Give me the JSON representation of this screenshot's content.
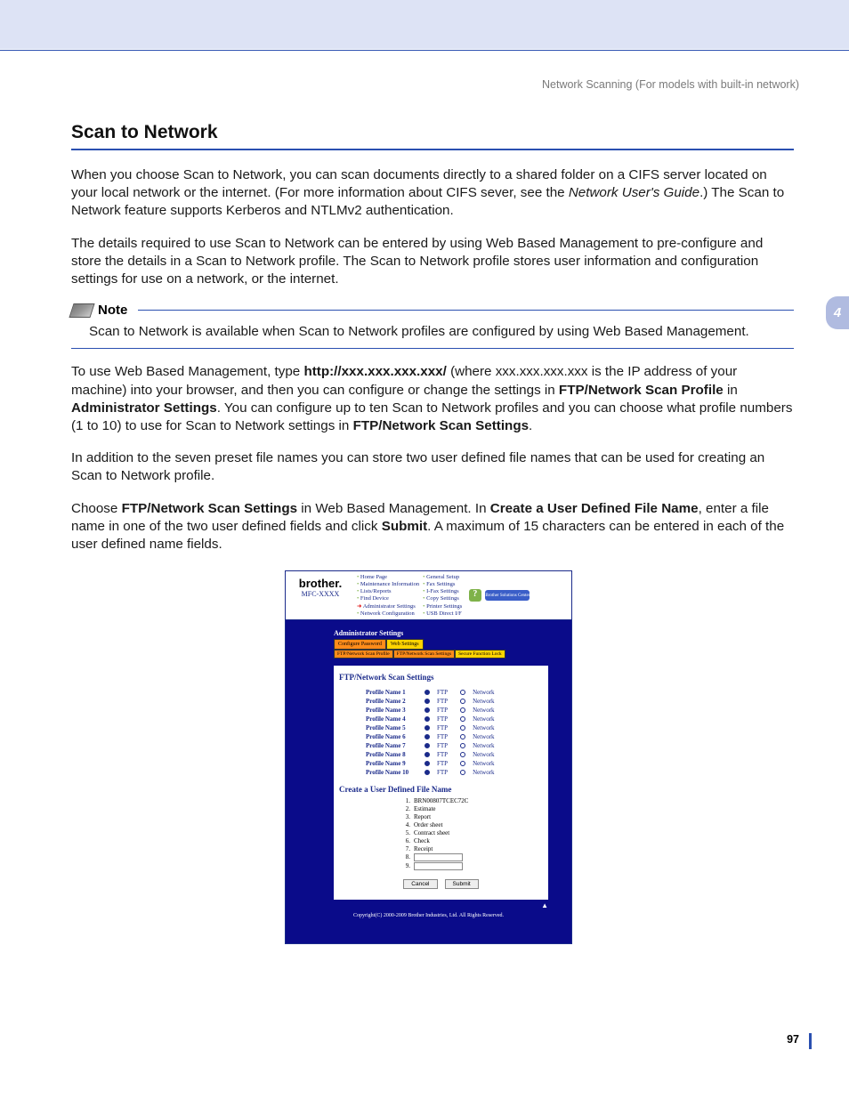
{
  "chapter_number": "4",
  "running_head": "Network Scanning (For models with built-in network)",
  "page_number": "97",
  "heading": "Scan to Network",
  "paragraphs": {
    "p1_a": "When you choose Scan to Network, you can scan documents directly to a shared folder on a CIFS server located on your local network or the internet. (For more information about CIFS sever, see the ",
    "p1_i": "Network User's Guide",
    "p1_b": ".) The Scan to Network feature supports Kerberos and NTLMv2 authentication.",
    "p2": "The details required to use Scan to Network can be entered by using Web Based Management to pre-configure and store the details in a Scan to Network profile. The Scan to Network profile stores user information and configuration settings for use on a network, or the internet.",
    "p3_a": "To use Web Based Management, type ",
    "p3_b": "http://xxx.xxx.xxx.xxx/",
    "p3_c": " (where xxx.xxx.xxx.xxx is the IP address of your machine) into your browser, and then you can configure or change the settings in ",
    "p3_d": "FTP/Network Scan Profile",
    "p3_e": " in ",
    "p3_f": "Administrator Settings",
    "p3_g": ". You can configure up to ten Scan to Network profiles and you can choose what profile numbers (1 to 10) to use for Scan to Network settings in ",
    "p3_h": "FTP/Network Scan Settings",
    "p3_i": ".",
    "p4": "In addition to the seven preset file names you can store two user defined file names that can be used for creating an Scan to Network profile.",
    "p5_a": "Choose ",
    "p5_b": "FTP/Network Scan Settings",
    "p5_c": " in Web Based Management. In ",
    "p5_d": "Create a User Defined File Name",
    "p5_e": ", enter a file name in one of the two user defined fields and click ",
    "p5_f": "Submit",
    "p5_g": ". A maximum of 15 characters can be entered in each of the user defined name fields."
  },
  "note": {
    "label": "Note",
    "body": "Scan to Network is available when Scan to Network profiles are configured by using Web Based Management."
  },
  "webshot": {
    "brand": "brother.",
    "model": "MFC-XXXX",
    "nav_left": [
      "Home Page",
      "Maintenance Information",
      "Lists/Reports",
      "Find Device",
      "Administrator Settings",
      "Network Configuration"
    ],
    "nav_right": [
      "General Setup",
      "Fax Settings",
      "I-Fax Settings",
      "Copy Settings",
      "Printer Settings",
      "USB Direct I/F"
    ],
    "bsc": "Brother Solutions Center",
    "admin_title": "Administrator Settings",
    "tabs1": [
      "Configure Password",
      "Web Settings"
    ],
    "tabs2": [
      "FTP/Network Scan Profile",
      "FTP/Network Scan Settings",
      "Secure Function Lock"
    ],
    "panel_title": "FTP/Network Scan Settings",
    "profile_label_prefix": "Profile Name ",
    "radio_ftp": "FTP",
    "radio_net": "Network",
    "profiles": [
      {
        "n": "1",
        "sel": "ftp"
      },
      {
        "n": "2",
        "sel": "ftp"
      },
      {
        "n": "3",
        "sel": "ftp"
      },
      {
        "n": "4",
        "sel": "ftp"
      },
      {
        "n": "5",
        "sel": "ftp"
      },
      {
        "n": "6",
        "sel": "ftp"
      },
      {
        "n": "7",
        "sel": "ftp"
      },
      {
        "n": "8",
        "sel": "ftp"
      },
      {
        "n": "9",
        "sel": "ftp"
      },
      {
        "n": "10",
        "sel": "ftp"
      }
    ],
    "panel_title2": "Create a User Defined File Name",
    "filenames": [
      {
        "n": "1.",
        "v": "BRN00807TCEC72C"
      },
      {
        "n": "2.",
        "v": "Estimate"
      },
      {
        "n": "3.",
        "v": "Report"
      },
      {
        "n": "4.",
        "v": "Order sheet"
      },
      {
        "n": "5.",
        "v": "Contract sheet"
      },
      {
        "n": "6.",
        "v": "Check"
      },
      {
        "n": "7.",
        "v": "Receipt"
      },
      {
        "n": "8.",
        "v": ""
      },
      {
        "n": "9.",
        "v": ""
      }
    ],
    "cancel": "Cancel",
    "submit": "Submit",
    "copyright": "Copyright(C) 2000-2009 Brother Industries, Ltd. All Rights Reserved."
  }
}
